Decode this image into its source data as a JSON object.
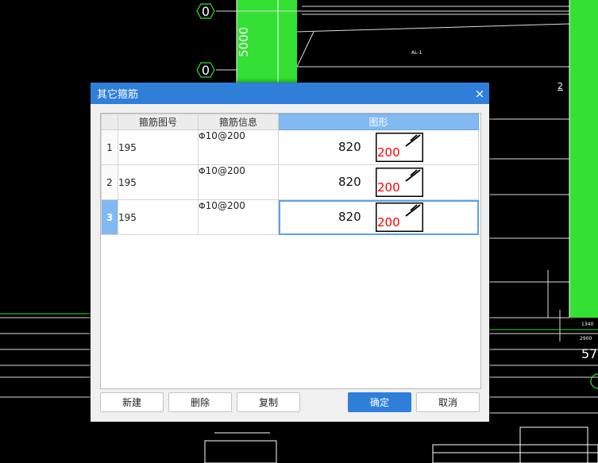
{
  "background": {
    "axis_markers": [
      "0",
      "0"
    ],
    "dimension_vertical": "5000",
    "label_right_2": "2",
    "label_small_al": "AL-1",
    "label_57": "57",
    "dims_bottom_right": [
      "1340",
      "2900"
    ]
  },
  "dialog": {
    "title": "其它箍筋",
    "close_icon": "×",
    "columns": [
      "箍筋图号",
      "箍筋信息",
      "图形"
    ],
    "rows": [
      {
        "num": "1",
        "code": "195",
        "info_symbol": "Φ",
        "info": "10@200",
        "length": "820",
        "width_label": "200",
        "selected": false
      },
      {
        "num": "2",
        "code": "195",
        "info_symbol": "Φ",
        "info": "10@200",
        "length": "820",
        "width_label": "200",
        "selected": false
      },
      {
        "num": "3",
        "code": "195",
        "info_symbol": "Φ",
        "info": "10@200",
        "length": "820",
        "width_label": "200",
        "selected": true
      }
    ],
    "buttons": {
      "new": "新建",
      "delete": "删除",
      "copy": "复制",
      "ok": "确定",
      "cancel": "取消"
    },
    "colors": {
      "accent": "#2f7fd9",
      "selected_header": "#82b9f0",
      "cad_green": "#33e033",
      "dim_red": "#ff0000"
    }
  }
}
